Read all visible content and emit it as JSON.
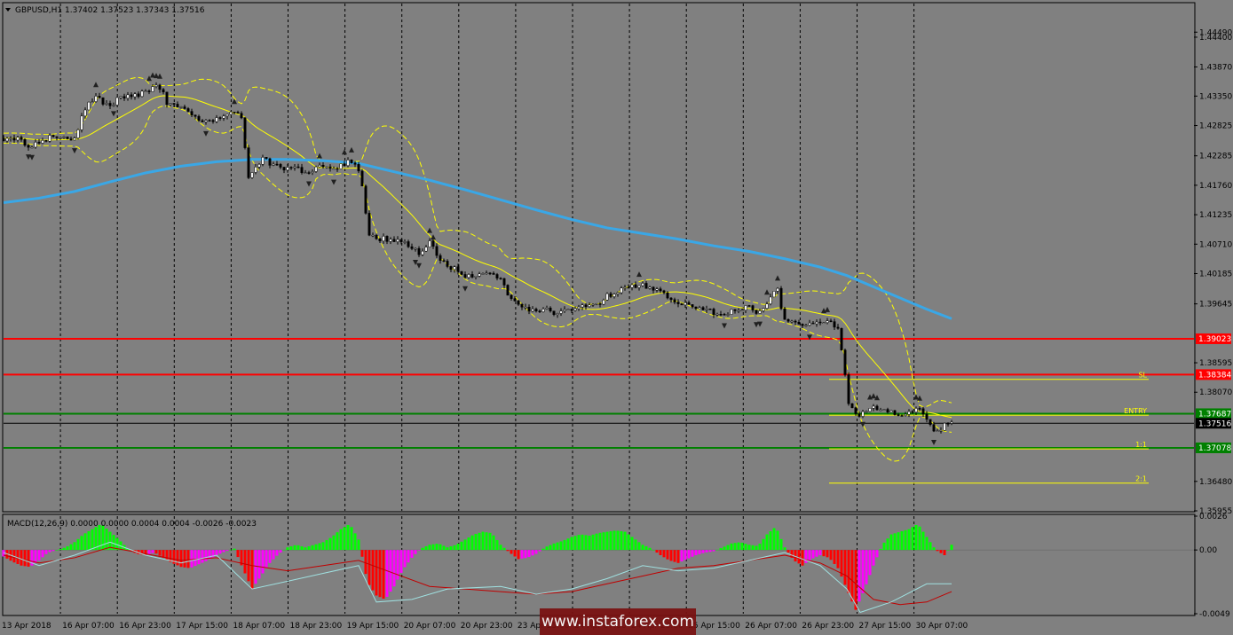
{
  "header": {
    "symbol_info": "GBPUSD,H1  1.37402 1.37523 1.37343 1.37516"
  },
  "colors": {
    "background": "#808080",
    "sma": "#3aa7e6",
    "bands": "#ffff00",
    "candle_up": "#ffffff",
    "candle_down": "#000000",
    "resistance": "#ff0000",
    "support": "#00a000",
    "histogram_up": "#00ff00",
    "histogram_down_red": "#ff0000",
    "histogram_down_magenta": "#ff00ff",
    "macd_line": "#9fe0e0",
    "signal_line": "#c00000"
  },
  "chart_data": {
    "type": "candlestick",
    "symbol": "GBPUSD",
    "timeframe": "H1",
    "ylim": [
      1.35955,
      1.45
    ],
    "y_ticks": [
      "1.44490",
      "1.44400",
      "1.43870",
      "1.43350",
      "1.42825",
      "1.42285",
      "1.41760",
      "1.41235",
      "1.40710",
      "1.40185",
      "1.39645",
      "1.38595",
      "1.38070",
      "1.36480",
      "1.35955"
    ],
    "x_ticks": [
      "13 Apr 2018",
      "16 Apr 07:00",
      "16 Apr 23:00",
      "17 Apr 15:00",
      "18 Apr 07:00",
      "18 Apr 23:00",
      "19 Apr 15:00",
      "20 Apr 07:00",
      "20 Apr 23:00",
      "23 Apr 15:00",
      "24 Apr 07:00",
      "24 Apr 23:00",
      "25 Apr 15:00",
      "26 Apr 07:00",
      "26 Apr 23:00",
      "27 Apr 15:00",
      "30 Apr 07:00"
    ],
    "close_path": [
      [
        0,
        1.426
      ],
      [
        8,
        1.4262
      ],
      [
        20,
        1.4255
      ],
      [
        30,
        1.4245
      ],
      [
        40,
        1.425
      ],
      [
        52,
        1.4262
      ],
      [
        64,
        1.4265
      ],
      [
        72,
        1.4262
      ],
      [
        80,
        1.4258
      ],
      [
        88,
        1.43
      ],
      [
        96,
        1.432
      ],
      [
        104,
        1.4335
      ],
      [
        112,
        1.4325
      ],
      [
        120,
        1.432
      ],
      [
        130,
        1.433
      ],
      [
        140,
        1.4338
      ],
      [
        150,
        1.4338
      ],
      [
        160,
        1.434
      ],
      [
        168,
        1.4352
      ],
      [
        176,
        1.435
      ],
      [
        184,
        1.4325
      ],
      [
        192,
        1.432
      ],
      [
        200,
        1.4315
      ],
      [
        210,
        1.43
      ],
      [
        220,
        1.429
      ],
      [
        230,
        1.4288
      ],
      [
        240,
        1.4295
      ],
      [
        250,
        1.43
      ],
      [
        260,
        1.4305
      ],
      [
        268,
        1.4295
      ],
      [
        276,
        1.419
      ],
      [
        284,
        1.421
      ],
      [
        292,
        1.4222
      ],
      [
        300,
        1.4215
      ],
      [
        310,
        1.421
      ],
      [
        320,
        1.4205
      ],
      [
        330,
        1.4208
      ],
      [
        340,
        1.4195
      ],
      [
        350,
        1.4205
      ],
      [
        360,
        1.421
      ],
      [
        370,
        1.42
      ],
      [
        380,
        1.421
      ],
      [
        390,
        1.4222
      ],
      [
        400,
        1.4205
      ],
      [
        406,
        1.416
      ],
      [
        410,
        1.4085
      ],
      [
        420,
        1.4082
      ],
      [
        430,
        1.408
      ],
      [
        440,
        1.4078
      ],
      [
        450,
        1.4075
      ],
      [
        460,
        1.4065
      ],
      [
        470,
        1.405
      ],
      [
        480,
        1.4075
      ],
      [
        490,
        1.4045
      ],
      [
        500,
        1.403
      ],
      [
        510,
        1.4025
      ],
      [
        520,
        1.4012
      ],
      [
        530,
        1.4018
      ],
      [
        540,
        1.402
      ],
      [
        550,
        1.4015
      ],
      [
        560,
        1.4005
      ],
      [
        570,
        1.3978
      ],
      [
        580,
        1.3965
      ],
      [
        590,
        1.3955
      ],
      [
        600,
        1.395
      ],
      [
        610,
        1.3955
      ],
      [
        620,
        1.395
      ],
      [
        630,
        1.3948
      ],
      [
        640,
        1.3955
      ],
      [
        650,
        1.396
      ],
      [
        660,
        1.396
      ],
      [
        670,
        1.3965
      ],
      [
        680,
        1.3978
      ],
      [
        690,
        1.3985
      ],
      [
        700,
        1.399
      ],
      [
        710,
        1.3995
      ],
      [
        720,
        1.3998
      ],
      [
        730,
        1.399
      ],
      [
        740,
        1.3985
      ],
      [
        750,
        1.3975
      ],
      [
        760,
        1.3968
      ],
      [
        770,
        1.3965
      ],
      [
        780,
        1.396
      ],
      [
        790,
        1.3958
      ],
      [
        800,
        1.395
      ],
      [
        810,
        1.3945
      ],
      [
        820,
        1.395
      ],
      [
        830,
        1.3955
      ],
      [
        840,
        1.396
      ],
      [
        850,
        1.3945
      ],
      [
        860,
        1.3965
      ],
      [
        866,
        1.3985
      ],
      [
        872,
        1.399
      ],
      [
        878,
        1.394
      ],
      [
        890,
        1.3935
      ],
      [
        900,
        1.3928
      ],
      [
        910,
        1.3925
      ],
      [
        920,
        1.393
      ],
      [
        930,
        1.3935
      ],
      [
        940,
        1.392
      ],
      [
        946,
        1.386
      ],
      [
        952,
        1.3785
      ],
      [
        958,
        1.377
      ],
      [
        964,
        1.376
      ],
      [
        970,
        1.3775
      ],
      [
        980,
        1.378
      ],
      [
        990,
        1.3772
      ],
      [
        1000,
        1.377
      ],
      [
        1010,
        1.3768
      ],
      [
        1020,
        1.377
      ],
      [
        1030,
        1.378
      ],
      [
        1036,
        1.3768
      ],
      [
        1042,
        1.3755
      ],
      [
        1048,
        1.3738
      ],
      [
        1054,
        1.3735
      ],
      [
        1060,
        1.3748
      ],
      [
        1068,
        1.3752
      ]
    ],
    "sma_path": [
      [
        0,
        1.4145
      ],
      [
        40,
        1.4153
      ],
      [
        80,
        1.4165
      ],
      [
        120,
        1.4182
      ],
      [
        160,
        1.4198
      ],
      [
        200,
        1.421
      ],
      [
        240,
        1.4218
      ],
      [
        280,
        1.4222
      ],
      [
        320,
        1.4222
      ],
      [
        360,
        1.422
      ],
      [
        400,
        1.4215
      ],
      [
        440,
        1.42
      ],
      [
        480,
        1.4185
      ],
      [
        520,
        1.4168
      ],
      [
        560,
        1.415
      ],
      [
        600,
        1.4132
      ],
      [
        640,
        1.4115
      ],
      [
        680,
        1.41
      ],
      [
        720,
        1.409
      ],
      [
        760,
        1.408
      ],
      [
        800,
        1.4068
      ],
      [
        840,
        1.4058
      ],
      [
        880,
        1.4045
      ],
      [
        920,
        1.403
      ],
      [
        950,
        1.4015
      ],
      [
        980,
        1.3995
      ],
      [
        1010,
        1.3975
      ],
      [
        1040,
        1.3955
      ],
      [
        1068,
        1.3938
      ]
    ],
    "levels": [
      {
        "value": 1.39023,
        "label": "1.39023",
        "color": "#ff0000"
      },
      {
        "value": 1.38384,
        "label": "1.38384",
        "color": "#ff0000"
      },
      {
        "value": 1.37687,
        "label": "1.37687",
        "color": "#008000"
      },
      {
        "value": 1.37078,
        "label": "1.37078",
        "color": "#008000"
      }
    ],
    "current_price": {
      "value": 1.37516,
      "label": "1.37516"
    },
    "zones": [
      {
        "value": 1.383,
        "label": "SL"
      },
      {
        "value": 1.3766,
        "label": "ENTRY"
      },
      {
        "value": 1.3706,
        "label": "1:1"
      },
      {
        "value": 1.3645,
        "label": "2:1"
      }
    ],
    "macd": {
      "title": "MACD(12,26,9) 0.0000 0.0000 0.0004 0.0004 -0.0026 -0.0023",
      "ylim": [
        -0.0049,
        0.0026
      ],
      "y_ticks": [
        "0.0026",
        "0.00",
        "-0.0049"
      ],
      "histogram": [
        [
          0,
          -0.0005
        ],
        [
          10,
          -0.0009
        ],
        [
          20,
          -0.0012
        ],
        [
          30,
          -0.0013
        ],
        [
          40,
          -0.0008
        ],
        [
          50,
          -0.0002
        ],
        [
          60,
          0.0
        ],
        [
          70,
          0.0002
        ],
        [
          80,
          0.0006
        ],
        [
          90,
          0.0012
        ],
        [
          100,
          0.0016
        ],
        [
          110,
          0.002
        ],
        [
          120,
          0.0014
        ],
        [
          130,
          0.0008
        ],
        [
          140,
          0.0001
        ],
        [
          150,
          -0.0003
        ],
        [
          160,
          -0.0004
        ],
        [
          170,
          -0.0002
        ],
        [
          180,
          -0.0006
        ],
        [
          190,
          -0.001
        ],
        [
          200,
          -0.0013
        ],
        [
          210,
          -0.0014
        ],
        [
          220,
          -0.0011
        ],
        [
          230,
          -0.0008
        ],
        [
          240,
          -0.0004
        ],
        [
          250,
          -0.0001
        ],
        [
          260,
          0.0001
        ],
        [
          270,
          -0.0015
        ],
        [
          280,
          -0.003
        ],
        [
          290,
          -0.002
        ],
        [
          300,
          -0.001
        ],
        [
          310,
          -0.0003
        ],
        [
          320,
          0.0002
        ],
        [
          330,
          0.0004
        ],
        [
          340,
          0.0002
        ],
        [
          350,
          0.0004
        ],
        [
          360,
          0.0006
        ],
        [
          370,
          0.001
        ],
        [
          380,
          0.0016
        ],
        [
          390,
          0.002
        ],
        [
          400,
          0.0008
        ],
        [
          410,
          -0.0025
        ],
        [
          420,
          -0.0035
        ],
        [
          430,
          -0.0038
        ],
        [
          440,
          -0.0028
        ],
        [
          450,
          -0.0015
        ],
        [
          460,
          -0.0006
        ],
        [
          470,
          0.0001
        ],
        [
          480,
          0.0004
        ],
        [
          490,
          0.0005
        ],
        [
          500,
          0.0002
        ],
        [
          510,
          0.0004
        ],
        [
          520,
          0.0008
        ],
        [
          530,
          0.0012
        ],
        [
          540,
          0.0014
        ],
        [
          550,
          0.0013
        ],
        [
          560,
          0.0004
        ],
        [
          570,
          -0.0002
        ],
        [
          580,
          -0.0007
        ],
        [
          590,
          -0.0006
        ],
        [
          600,
          -0.0003
        ],
        [
          610,
          0.0002
        ],
        [
          620,
          0.0005
        ],
        [
          630,
          0.0007
        ],
        [
          640,
          0.001
        ],
        [
          650,
          0.0012
        ],
        [
          660,
          0.0011
        ],
        [
          670,
          0.0013
        ],
        [
          680,
          0.0014
        ],
        [
          690,
          0.0015
        ],
        [
          700,
          0.0014
        ],
        [
          710,
          0.0009
        ],
        [
          720,
          0.0004
        ],
        [
          730,
          0.0001
        ],
        [
          740,
          -0.0004
        ],
        [
          750,
          -0.0008
        ],
        [
          760,
          -0.001
        ],
        [
          770,
          -0.0007
        ],
        [
          780,
          -0.0004
        ],
        [
          790,
          -0.0002
        ],
        [
          800,
          -0.0001
        ],
        [
          810,
          0.0002
        ],
        [
          820,
          0.0005
        ],
        [
          830,
          0.0006
        ],
        [
          840,
          0.0004
        ],
        [
          850,
          0.0003
        ],
        [
          860,
          0.0012
        ],
        [
          870,
          0.0018
        ],
        [
          880,
          0.0002
        ],
        [
          890,
          -0.0008
        ],
        [
          900,
          -0.0012
        ],
        [
          910,
          -0.0007
        ],
        [
          920,
          -0.0004
        ],
        [
          930,
          -0.0006
        ],
        [
          940,
          -0.0014
        ],
        [
          950,
          -0.003
        ],
        [
          960,
          -0.0046
        ],
        [
          970,
          -0.003
        ],
        [
          980,
          -0.0012
        ],
        [
          990,
          0.0004
        ],
        [
          1000,
          0.0012
        ],
        [
          1010,
          0.0014
        ],
        [
          1020,
          0.0016
        ],
        [
          1030,
          0.002
        ],
        [
          1040,
          0.001
        ],
        [
          1050,
          0.0
        ],
        [
          1060,
          -0.0004
        ],
        [
          1068,
          0.0004
        ]
      ],
      "signal": [
        [
          0,
          -0.0004
        ],
        [
          40,
          -0.001
        ],
        [
          80,
          -0.0006
        ],
        [
          120,
          0.0002
        ],
        [
          160,
          -0.0003
        ],
        [
          200,
          -0.0008
        ],
        [
          240,
          -0.0006
        ],
        [
          280,
          -0.0012
        ],
        [
          320,
          -0.0016
        ],
        [
          360,
          -0.0012
        ],
        [
          400,
          -0.0008
        ],
        [
          440,
          -0.0018
        ],
        [
          480,
          -0.0028
        ],
        [
          520,
          -0.003
        ],
        [
          560,
          -0.0032
        ],
        [
          600,
          -0.0034
        ],
        [
          640,
          -0.0032
        ],
        [
          680,
          -0.0026
        ],
        [
          720,
          -0.002
        ],
        [
          760,
          -0.0014
        ],
        [
          800,
          -0.0012
        ],
        [
          840,
          -0.0008
        ],
        [
          880,
          -0.0004
        ],
        [
          920,
          -0.001
        ],
        [
          950,
          -0.002
        ],
        [
          980,
          -0.0038
        ],
        [
          1010,
          -0.0042
        ],
        [
          1040,
          -0.004
        ],
        [
          1068,
          -0.0032
        ]
      ],
      "macd_line": [
        [
          0,
          -0.0002
        ],
        [
          40,
          -0.0012
        ],
        [
          80,
          -0.0004
        ],
        [
          120,
          0.0006
        ],
        [
          160,
          -0.0004
        ],
        [
          200,
          -0.001
        ],
        [
          240,
          -0.0004
        ],
        [
          280,
          -0.003
        ],
        [
          320,
          -0.0024
        ],
        [
          360,
          -0.0018
        ],
        [
          400,
          -0.0012
        ],
        [
          420,
          -0.004
        ],
        [
          460,
          -0.0038
        ],
        [
          500,
          -0.003
        ],
        [
          560,
          -0.0028
        ],
        [
          600,
          -0.0034
        ],
        [
          640,
          -0.003
        ],
        [
          680,
          -0.0022
        ],
        [
          720,
          -0.0012
        ],
        [
          760,
          -0.0016
        ],
        [
          800,
          -0.0014
        ],
        [
          840,
          -0.0008
        ],
        [
          880,
          -0.0002
        ],
        [
          920,
          -0.0012
        ],
        [
          950,
          -0.003
        ],
        [
          965,
          -0.0048
        ],
        [
          1000,
          -0.004
        ],
        [
          1040,
          -0.0026
        ],
        [
          1068,
          -0.0026
        ]
      ]
    }
  },
  "watermark": {
    "text": "www.instaforex.com"
  }
}
